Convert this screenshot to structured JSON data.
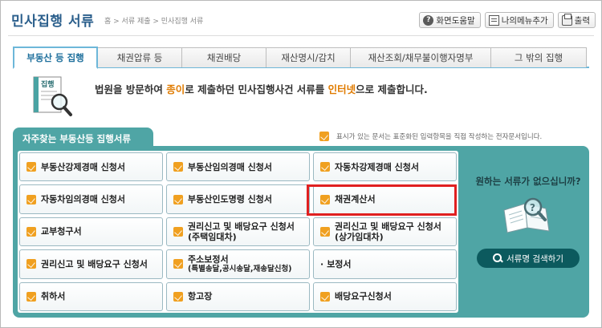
{
  "header": {
    "title": "민사집행 서류",
    "breadcrumb": "홈 > 서류 제출 > 민사집행 서류",
    "buttons": {
      "help": "화면도움말",
      "my_menu": "나의메뉴추가",
      "print": "출력"
    }
  },
  "tabs": [
    {
      "label": "부동산 등 집행",
      "active": true
    },
    {
      "label": "채권압류 등",
      "active": false
    },
    {
      "label": "채권배당",
      "active": false
    },
    {
      "label": "재산명시/감치",
      "active": false
    },
    {
      "label": "재산조회/채무불이행자명부",
      "active": false
    },
    {
      "label": "그 밖의 집행",
      "active": false
    }
  ],
  "intro": {
    "icon_label": "집행",
    "part1": "법원을 방문하여 ",
    "highlight1": "종이",
    "part2": "로 제출하던 민사집행사건 서류를 ",
    "highlight2": "인터넷",
    "part3": "으로 제출합니다."
  },
  "panel": {
    "title": "자주찾는 부동산등 집행서류",
    "note": "표시가 있는 문서는 표준화된 입력항목을 직접 작성하는 전자문서입니다.",
    "items": [
      {
        "label": "부동산강제경매 신청서",
        "sub": ""
      },
      {
        "label": "부동산임의경매 신청서",
        "sub": ""
      },
      {
        "label": "자동차강제경매 신청서",
        "sub": ""
      },
      {
        "label": "자동차임의경매 신청서",
        "sub": ""
      },
      {
        "label": "부동산인도명령 신청서",
        "sub": ""
      },
      {
        "label": "채권계산서",
        "sub": ""
      },
      {
        "label": "교부청구서",
        "sub": ""
      },
      {
        "label": "권리신고 및 배당요구 신청서",
        "sub": "(주택임대차)"
      },
      {
        "label": "권리신고 및 배당요구 신청서",
        "sub": "(상가임대차)"
      },
      {
        "label": "권리신고 및 배당요구 신청서",
        "sub": ""
      },
      {
        "label": "주소보정서",
        "sub": "(특별송달,공시송달,재송달신청)"
      },
      {
        "label": "보정서",
        "sub": ""
      },
      {
        "label": "취하서",
        "sub": ""
      },
      {
        "label": "항고장",
        "sub": ""
      },
      {
        "label": "배당요구신청서",
        "sub": ""
      }
    ],
    "side": {
      "question": "원하는 서류가 없으십니까?",
      "search_button": "서류명 검색하기"
    }
  },
  "colors": {
    "title_blue": "#2b5f8c",
    "tab_accent": "#6db7d9",
    "panel_teal": "#4fa5a5",
    "search_button": "#0c5a5e",
    "highlight_orange": "#e07b00",
    "edoc_icon": "#f0a020",
    "selection_red": "#e02020"
  }
}
